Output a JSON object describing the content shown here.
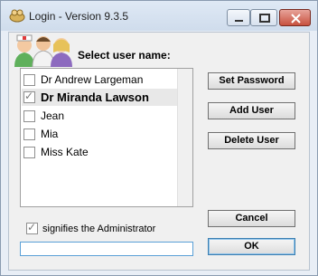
{
  "window": {
    "title": "Login - Version 9.3.5"
  },
  "main": {
    "select_label": "Select user name:",
    "users": [
      {
        "name": "Dr Andrew Largeman",
        "admin": false,
        "selected": false
      },
      {
        "name": "Dr Miranda Lawson",
        "admin": true,
        "selected": true
      },
      {
        "name": "Jean",
        "admin": false,
        "selected": false
      },
      {
        "name": "Mia",
        "admin": false,
        "selected": false
      },
      {
        "name": "Miss Kate",
        "admin": false,
        "selected": false
      }
    ],
    "admin_note": "signifies the Administrator",
    "password_value": ""
  },
  "buttons": {
    "set_password": "Set Password",
    "add_user": "Add User",
    "delete_user": "Delete User",
    "cancel": "Cancel",
    "ok": "OK"
  },
  "icons": {
    "app": "app-icon",
    "avatars": "staff-avatars-icon",
    "check": "check-icon"
  }
}
